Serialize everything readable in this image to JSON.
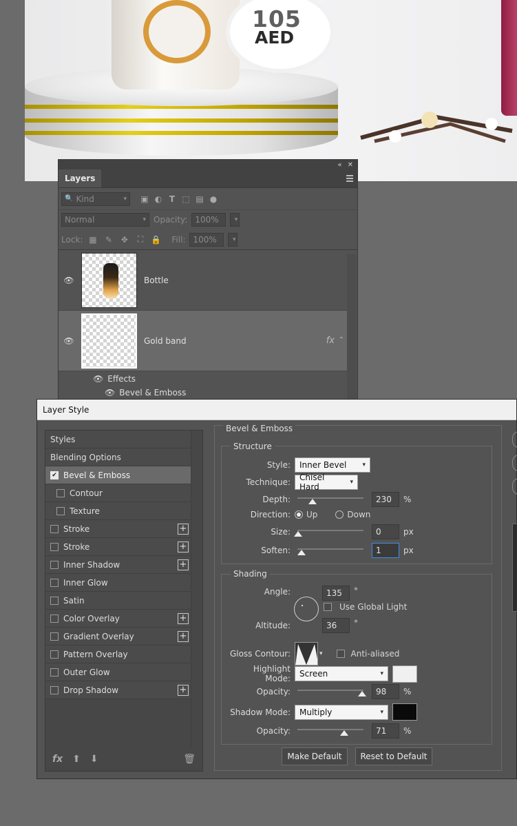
{
  "artwork": {
    "price_number": "105",
    "price_currency": "AED"
  },
  "layers_panel": {
    "tab": "Layers",
    "kind_label": "Kind",
    "blend_mode": "Normal",
    "opacity_label": "Opacity:",
    "opacity_value": "100%",
    "lock_label": "Lock:",
    "fill_label": "Fill:",
    "fill_value": "100%",
    "layers": [
      {
        "name": "Bottle"
      },
      {
        "name": "Gold band",
        "fx": "fx"
      }
    ],
    "effects_label": "Effects",
    "effect_item": "Bevel & Emboss"
  },
  "dialog": {
    "title": "Layer Style",
    "styles": [
      {
        "label": "Styles"
      },
      {
        "label": "Blending Options"
      },
      {
        "label": "Bevel & Emboss",
        "checked": true
      },
      {
        "label": "Contour"
      },
      {
        "label": "Texture"
      },
      {
        "label": "Stroke"
      },
      {
        "label": "Stroke"
      },
      {
        "label": "Inner Shadow"
      },
      {
        "label": "Inner Glow"
      },
      {
        "label": "Satin"
      },
      {
        "label": "Color Overlay"
      },
      {
        "label": "Gradient Overlay"
      },
      {
        "label": "Pattern Overlay"
      },
      {
        "label": "Outer Glow"
      },
      {
        "label": "Drop Shadow"
      }
    ],
    "footer": {
      "fx": "fx",
      "up": "⬆",
      "down": "⬇",
      "trash": "🗑"
    },
    "bevel": {
      "group_title": "Bevel & Emboss",
      "structure_title": "Structure",
      "style_label": "Style:",
      "style_value": "Inner Bevel",
      "technique_label": "Technique:",
      "technique_value": "Chisel Hard",
      "depth_label": "Depth:",
      "depth_value": "230",
      "depth_unit": "%",
      "direction_label": "Direction:",
      "direction_up": "Up",
      "direction_down": "Down",
      "size_label": "Size:",
      "size_value": "0",
      "size_unit": "px",
      "soften_label": "Soften:",
      "soften_value": "1",
      "soften_unit": "px"
    },
    "shading": {
      "title": "Shading",
      "angle_label": "Angle:",
      "angle_value": "135",
      "angle_unit": "°",
      "global_light_label": "Use Global Light",
      "altitude_label": "Altitude:",
      "altitude_value": "36",
      "altitude_unit": "°",
      "gloss_label": "Gloss Contour:",
      "anti_aliased_label": "Anti-aliased",
      "highlight_mode_label": "Highlight Mode:",
      "highlight_mode_value": "Screen",
      "highlight_color": "#f0f0f0",
      "highlight_opacity_label": "Opacity:",
      "highlight_opacity_value": "98",
      "highlight_opacity_unit": "%",
      "shadow_mode_label": "Shadow Mode:",
      "shadow_mode_value": "Multiply",
      "shadow_color": "#0a0a0a",
      "shadow_opacity_label": "Opacity:",
      "shadow_opacity_value": "71",
      "shadow_opacity_unit": "%"
    },
    "buttons": {
      "make_default": "Make Default",
      "reset_default": "Reset to Default"
    }
  }
}
